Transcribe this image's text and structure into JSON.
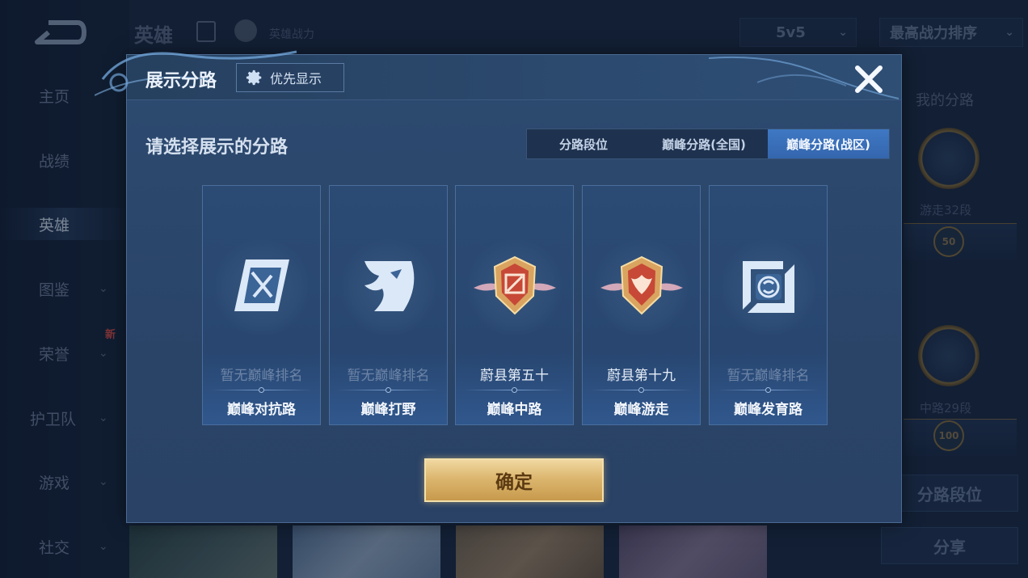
{
  "background": {
    "back_icon": "back-arrow-icon",
    "nav": [
      {
        "label": "主页",
        "chevron": false
      },
      {
        "label": "战绩",
        "chevron": false
      },
      {
        "label": "英雄",
        "chevron": false,
        "active": true
      },
      {
        "label": "图鉴",
        "chevron": true
      },
      {
        "label": "荣誉",
        "chevron": true,
        "badge": "新"
      },
      {
        "label": "护卫队",
        "chevron": true
      },
      {
        "label": "游戏",
        "chevron": true
      },
      {
        "label": "社交",
        "chevron": true
      }
    ],
    "chevron_glyph": "⌄",
    "header": {
      "title": "英雄",
      "subtitle": "英雄战力",
      "mode_select": "5v5",
      "sort_select": "最高战力排序"
    },
    "right_panel": {
      "label": "我的分路",
      "medal1_label": "游走32段",
      "medal1_level": "50",
      "medal2_label": "中路29段",
      "medal2_level": "100",
      "btn_lane_rank": "分路段位",
      "btn_share": "分享"
    }
  },
  "dialog": {
    "title": "展示分路",
    "priority_label": "优先显示",
    "close_icon": "close-icon",
    "prompt": "请选择展示的分路",
    "tabs": [
      {
        "label": "分路段位",
        "active": false
      },
      {
        "label": "巅峰分路(全国)",
        "active": false
      },
      {
        "label": "巅峰分路(战区)",
        "active": true
      }
    ],
    "cards": [
      {
        "rank": "暂无巅峰排名",
        "ranked": false,
        "role": "巅峰对抗路",
        "icon": "clash-lane-icon"
      },
      {
        "rank": "暂无巅峰排名",
        "ranked": false,
        "role": "巅峰打野",
        "icon": "jungle-dragon-icon"
      },
      {
        "rank": "蔚县第五十",
        "ranked": true,
        "role": "巅峰中路",
        "icon": "mid-lane-shield-icon"
      },
      {
        "rank": "蔚县第十九",
        "ranked": true,
        "role": "巅峰游走",
        "icon": "roam-shield-icon"
      },
      {
        "rank": "暂无巅峰排名",
        "ranked": false,
        "role": "巅峰发育路",
        "icon": "farm-lane-icon"
      }
    ],
    "confirm_label": "确定"
  },
  "colors": {
    "accent_tab": "#3f78c4",
    "confirm_gold": "#dcb66f",
    "dialog_bg": "#2d4a70"
  }
}
